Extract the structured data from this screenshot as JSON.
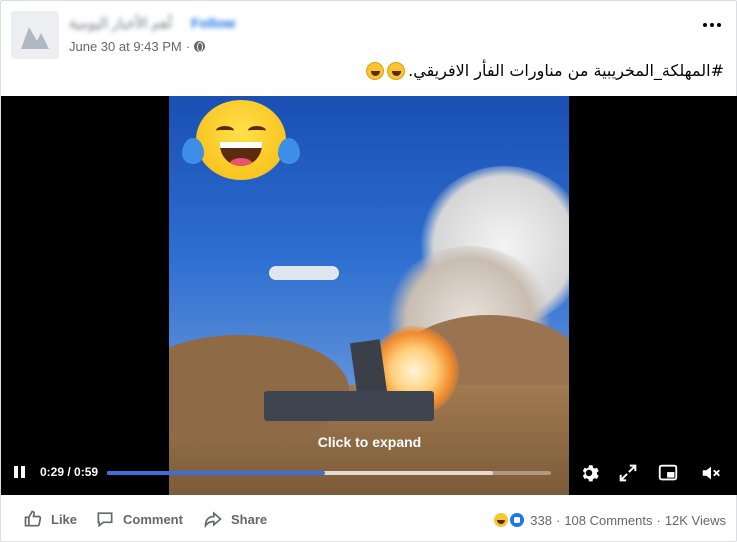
{
  "post": {
    "page_name": "أهم الأخبار اليومية",
    "follow_label": "Follow",
    "timestamp": "June 30 at 9:43 PM",
    "separator": "·",
    "caption": "#المهلكة_المخريبية من مناورات الفأر الافريقي."
  },
  "video": {
    "expand_text": "Click to expand",
    "time": "0:29 / 0:59",
    "played_fraction": 0.49,
    "buffered_fraction": 0.87
  },
  "actions": {
    "like": "Like",
    "comment": "Comment",
    "share": "Share"
  },
  "stats": {
    "reactions": "338",
    "comments": "108 Comments",
    "views": "12K Views",
    "dot": "·"
  },
  "icons": [
    "globe-icon",
    "more-icon",
    "pause-icon",
    "settings-icon",
    "fullscreen-icon",
    "pip-icon",
    "volume-muted-icon",
    "like-icon",
    "comment-icon",
    "share-icon"
  ],
  "colors": {
    "accent": "#1877f2",
    "progress": "#3b6fdc",
    "muted_text": "#65676b"
  }
}
